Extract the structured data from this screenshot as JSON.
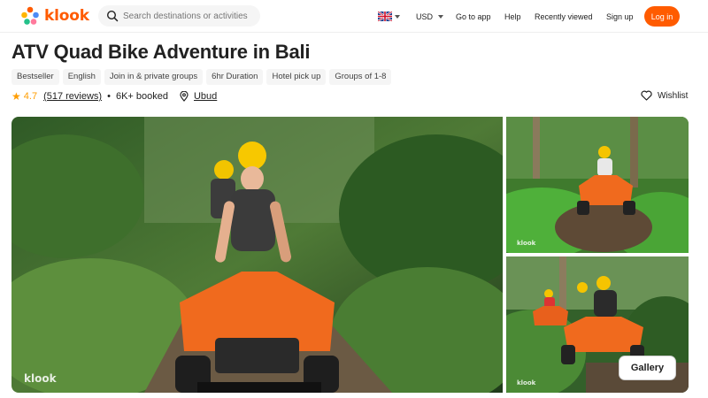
{
  "header": {
    "logo_text": "klook",
    "search_placeholder": "Search destinations or activities",
    "currency": "USD",
    "go_to_app": "Go to app",
    "help": "Help",
    "recently_viewed": "Recently viewed",
    "sign_up": "Sign up",
    "log_in": "Log in",
    "brand_color": "#ff5b00"
  },
  "activity": {
    "title": "ATV Quad Bike Adventure in Bali",
    "tags": [
      "Bestseller",
      "English",
      "Join in & private groups",
      "6hr Duration",
      "Hotel pick up",
      "Groups of 1-8"
    ],
    "rating": "4.7",
    "reviews": "(517 reviews)",
    "booked": "6K+ booked",
    "location": "Ubud",
    "wishlist": "Wishlist"
  },
  "gallery": {
    "button_label": "Gallery",
    "watermark": "klook",
    "images": [
      "atv-riders-jungle-trail",
      "atv-splashing-mud",
      "atv-group-forest"
    ]
  }
}
